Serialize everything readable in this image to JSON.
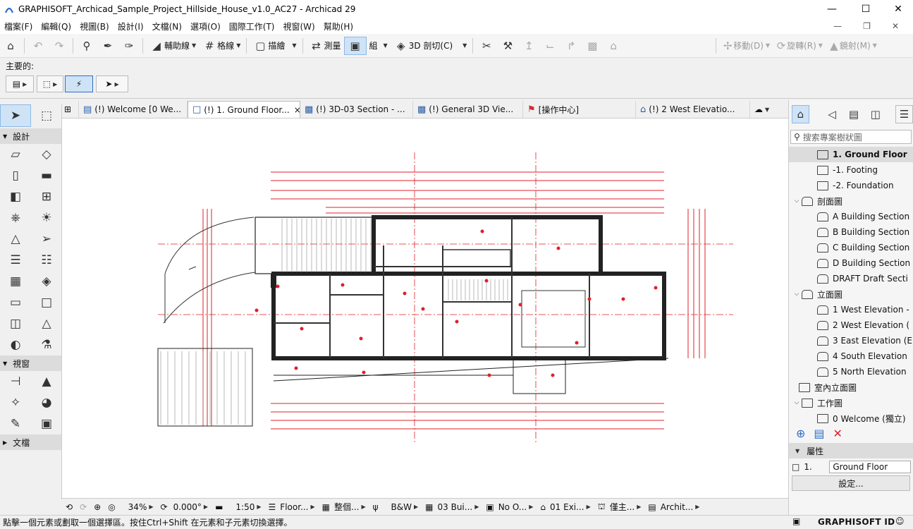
{
  "window": {
    "title": "GRAPHISOFT_Archicad_Sample_Project_Hillside_House_v1.0_AC27 - Archicad 29"
  },
  "menu": [
    "檔案(F)",
    "編輯(Q)",
    "視圖(B)",
    "設計(I)",
    "文檔(N)",
    "選項(O)",
    "國際工作(T)",
    "視窗(W)",
    "幫助(H)"
  ],
  "toolbar": {
    "guide": "輔助線",
    "grid": "格線",
    "trace": "描繪",
    "measure": "測量",
    "group": "組",
    "cut3d": "3D 剖切(C)",
    "move": "移動(D)",
    "rotate": "旋轉(R)",
    "mirror": "鏡射(M)"
  },
  "infobox": {
    "label": "主要的:"
  },
  "toolbox": {
    "design": "設計",
    "viewpoint": "視窗",
    "document": "文檔"
  },
  "tabs": [
    {
      "label": "(!) Welcome [0 We...",
      "icon": "layout-icon"
    },
    {
      "label": "(!) 1. Ground Floor...",
      "icon": "floorplan-icon",
      "close": "×"
    },
    {
      "label": "(!) 3D-03 Section - ...",
      "icon": "3d-icon"
    },
    {
      "label": "(!) General 3D Vie...",
      "icon": "3d-icon"
    },
    {
      "label": "[操作中心]",
      "icon": "action-center-icon"
    },
    {
      "label": "(!) 2 West Elevatio...",
      "icon": "elevation-icon"
    }
  ],
  "navigator": {
    "search_placeholder": "搜索專案樹狀圖",
    "items": [
      {
        "label": "1. Ground Floor",
        "level": 2,
        "icon": "story",
        "selected": true
      },
      {
        "label": "-1. Footing",
        "level": 2,
        "icon": "story"
      },
      {
        "label": "-2. Foundation",
        "level": 2,
        "icon": "story"
      },
      {
        "label": "剖面圖",
        "level": 1,
        "icon": "section-folder",
        "expand": "v"
      },
      {
        "label": "A Building Section",
        "level": 2,
        "icon": "section"
      },
      {
        "label": "B Building Section",
        "level": 2,
        "icon": "section"
      },
      {
        "label": "C Building Section",
        "level": 2,
        "icon": "section"
      },
      {
        "label": "D Building Section",
        "level": 2,
        "icon": "section"
      },
      {
        "label": "DRAFT Draft Secti",
        "level": 2,
        "icon": "section"
      },
      {
        "label": "立面圖",
        "level": 1,
        "icon": "elevation-folder",
        "expand": "v"
      },
      {
        "label": "1 West Elevation -",
        "level": 2,
        "icon": "elevation"
      },
      {
        "label": "2 West Elevation (",
        "level": 2,
        "icon": "elevation"
      },
      {
        "label": "3 East Elevation (E",
        "level": 2,
        "icon": "elevation"
      },
      {
        "label": "4 South Elevation",
        "level": 2,
        "icon": "elevation"
      },
      {
        "label": "5 North Elevation",
        "level": 2,
        "icon": "elevation"
      },
      {
        "label": "室內立面圖",
        "level": 1,
        "icon": "interior-elevation"
      },
      {
        "label": "工作圖",
        "level": 1,
        "icon": "worksheet-folder",
        "expand": "v"
      },
      {
        "label": "0 Welcome (獨立)",
        "level": 2,
        "icon": "worksheet"
      }
    ],
    "layers_title": "屬性",
    "story_label": "1.",
    "story_value": "Ground Floor",
    "settings_button": "設定..."
  },
  "statusnav": {
    "zoom": "34%",
    "angle": "0.000°",
    "scale": "1:50",
    "layer_combo": "Floor...",
    "model_view": "整個...",
    "pen_set": "B&W",
    "renovation": "03 Bui...",
    "override": "No O...",
    "dimension": "01 Exi...",
    "filter": "僅主...",
    "structure": "Archit..."
  },
  "statusbar": {
    "message": "點擊一個元素或劃取一個選擇區。按住Ctrl+Shift 在元素和子元素切換選擇。",
    "brand": "GRAPHISOFT ID"
  },
  "colors": {
    "accent": "#2a6fc9",
    "dimension_red": "#e0202a",
    "selected_blue": "#cfe3f6"
  }
}
